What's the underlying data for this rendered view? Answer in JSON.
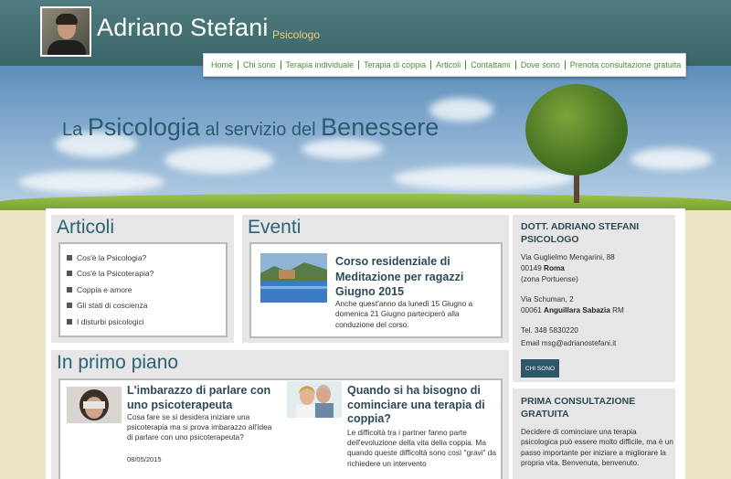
{
  "header": {
    "name": "Adriano Stefani",
    "role": "Psicologo"
  },
  "nav": {
    "items": [
      "Home",
      "Chi sono",
      "Terapia individuale",
      "Terapia di coppia",
      "Articoli",
      "Contattami",
      "Dove sono",
      "Prenota consultazione gratuita"
    ]
  },
  "hero": {
    "part1": "La ",
    "part2": "Psicologia",
    "part3": " al servizio del ",
    "part4": "Benessere"
  },
  "articoli": {
    "title": "Articoli",
    "items": [
      "Cos'è la Psicologia?",
      "Cos'è la Psicoterapia?",
      "Coppia e amore",
      "Gli stati di coscienza",
      "I disturbi psicologici"
    ]
  },
  "eventi": {
    "title": "Eventi",
    "event": {
      "title": "Corso residenziale di Meditazione per ragazzi Giugno 2015",
      "text": "Anche quest'anno da lunedì 15 Giugno a domenica 21 Giugno parteciperò alla conduzione del corso."
    }
  },
  "primo_piano": {
    "title": "In primo piano",
    "items": [
      {
        "title": "L'imbarazzo di parlare con uno psicoterapeuta",
        "text": "Cosa fare se si desidera iniziare una psicoterapia ma si prova imbarazzo all'idea di parlare con uno psicoterapeuta?",
        "date": "08/05/2015"
      },
      {
        "title": "Quando si ha bisogno di cominciare una terapia di coppia?",
        "text": "Le difficoltà tra i partner fanno parte dell'evoluzione della vita della coppia. Ma quando queste difficoltà sono così \"gravi\" da richiedere un intervento"
      }
    ]
  },
  "sidebar": {
    "contact_title": "DOTT. ADRIANO STEFANI PSICOLOGO",
    "address1_street": "Via Guglielmo Mengarini, 88",
    "address1_cap": "00149 ",
    "address1_city": "Roma",
    "address1_zone": "(zona Portuense)",
    "address2_street": "Via Schuman, 2",
    "address2_cap": "00061 ",
    "address2_city": "Anguillara Sabazia",
    "address2_prov": " RM",
    "phone": "Tel. 348 5830220",
    "email": "Email msg@adrianostefani.it",
    "button": "CHI SONO",
    "consult_title": "PRIMA CONSULTAZIONE GRATUITA",
    "consult_text": "Decidere di cominciare una terapia psicologica può essere molto difficile, ma è un passo importante per iniziare a migliorare la propria vita. Benvenuta, benvenuto."
  }
}
